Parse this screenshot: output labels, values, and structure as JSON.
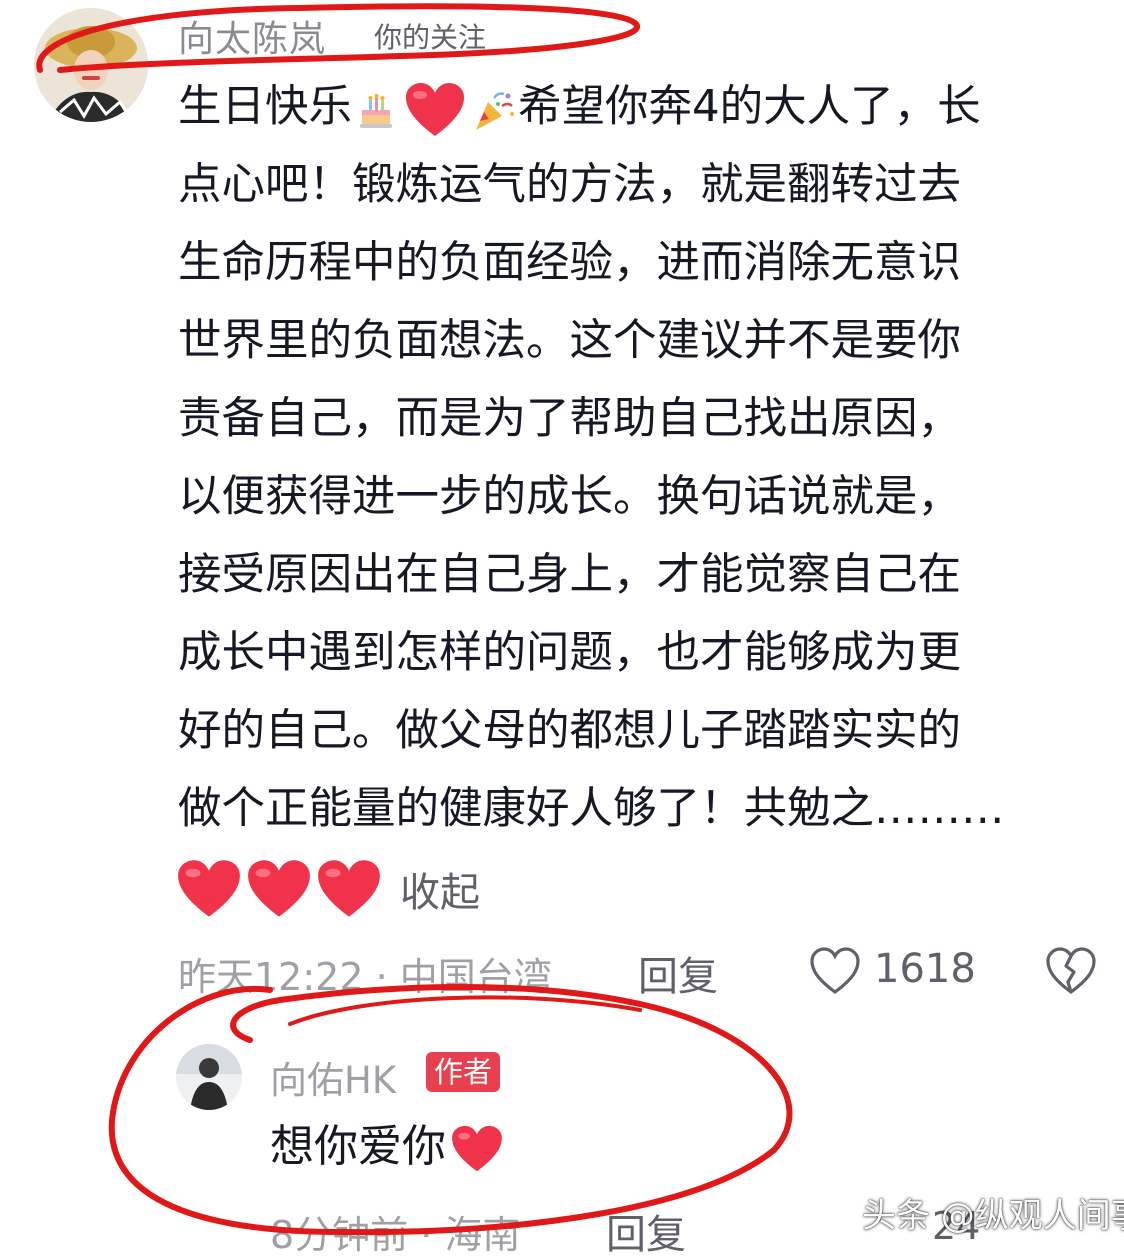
{
  "comment": {
    "username": "向太陈岚",
    "follow_tag": "你的关注",
    "lines": [
      "生日快乐",
      "希望你奔4的大人了，长",
      "点心吧！锻炼运气的方法，就是翻转过去",
      "生命历程中的负面经验，进而消除无意识",
      "世界里的负面想法。这个建议并不是要你",
      "责备自己，而是为了帮助自己找出原因，",
      "以便获得进一步的成长。换句话说就是，",
      "接受原因出在自己身上，才能觉察自己在",
      "成长中遇到怎样的问题，也才能够成为更",
      "好的自己。做父母的都想儿子踏踏实实的",
      "做个正能量的健康好人够了！共勉之………"
    ],
    "collapse_label": "收起",
    "timestamp": "昨天12:22 · 中国台湾",
    "reply_label": "回复",
    "like_count": "1618"
  },
  "reply": {
    "username": "向佑HK",
    "author_badge": "作者",
    "text": "想你爱你",
    "timestamp": "8分钟前 · 海南",
    "reply_label": "回复",
    "like_count": "24"
  },
  "watermark": "头条 @纵观人间事",
  "colors": {
    "primary_text": "#161823",
    "secondary_text": "#9fa0a5",
    "badge_bg": "#e8404f",
    "annotation_red": "#e01818",
    "heart_red": "#f0334b"
  },
  "icons": {
    "cake": "cake-emoji-icon",
    "heart": "red-heart-emoji-icon",
    "party": "party-popper-emoji-icon",
    "like": "heart-outline-icon",
    "dislike": "broken-heart-icon"
  }
}
